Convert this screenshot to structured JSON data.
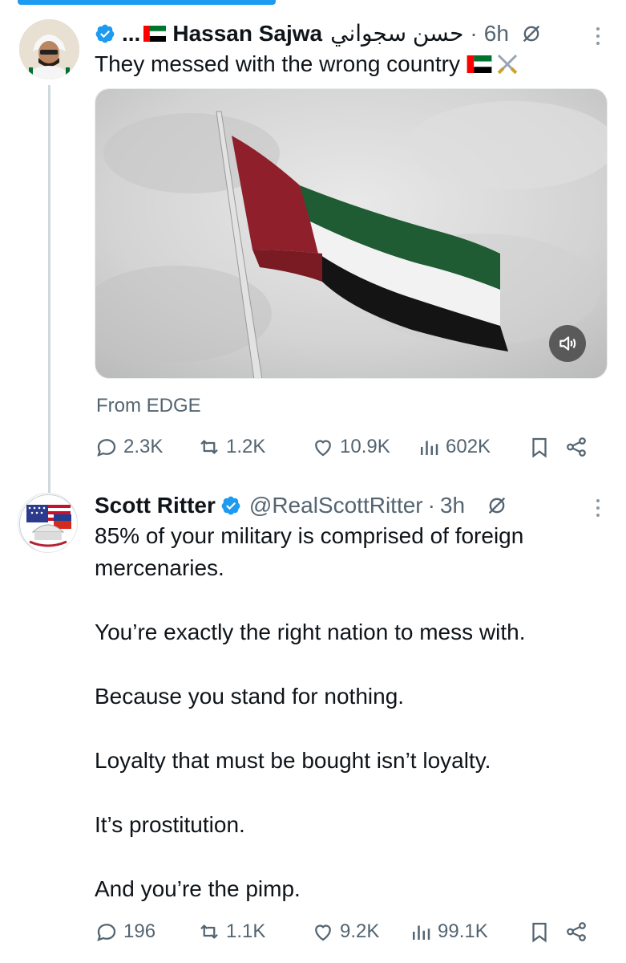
{
  "tweets": [
    {
      "author": {
        "display_name_prefix": "...",
        "display_name": "Hassan Sajwa",
        "arabic_name": "حسن سجواني",
        "verified": true,
        "avatar_icon": "avatar-photo"
      },
      "time": "6h",
      "text": "They messed with the wrong country",
      "media": {
        "type": "video",
        "description_icon": "flag-video",
        "volume_icon": "volume-icon"
      },
      "source": "From EDGE",
      "stats": {
        "replies": "2.3K",
        "reposts": "1.2K",
        "likes": "10.9K",
        "views": "602K"
      }
    },
    {
      "author": {
        "display_name": "Scott Ritter",
        "handle": "@RealScottRitter",
        "verified": true,
        "avatar_icon": "avatar-logo"
      },
      "time": "3h",
      "paragraphs": [
        "85% of your military is comprised of foreign",
        "mercenaries.",
        "You’re exactly the right nation to mess with.",
        "Because you stand for nothing.",
        "Loyalty that must be bought isn’t loyalty.",
        "It’s prostitution.",
        "And you’re the pimp."
      ],
      "stats": {
        "replies": "196",
        "reposts": "1.1K",
        "likes": "9.2K",
        "views": "99.1K"
      }
    }
  ],
  "colors": {
    "accent": "#1d9bf0",
    "muted_text": "#536471",
    "text": "#0f1419"
  }
}
